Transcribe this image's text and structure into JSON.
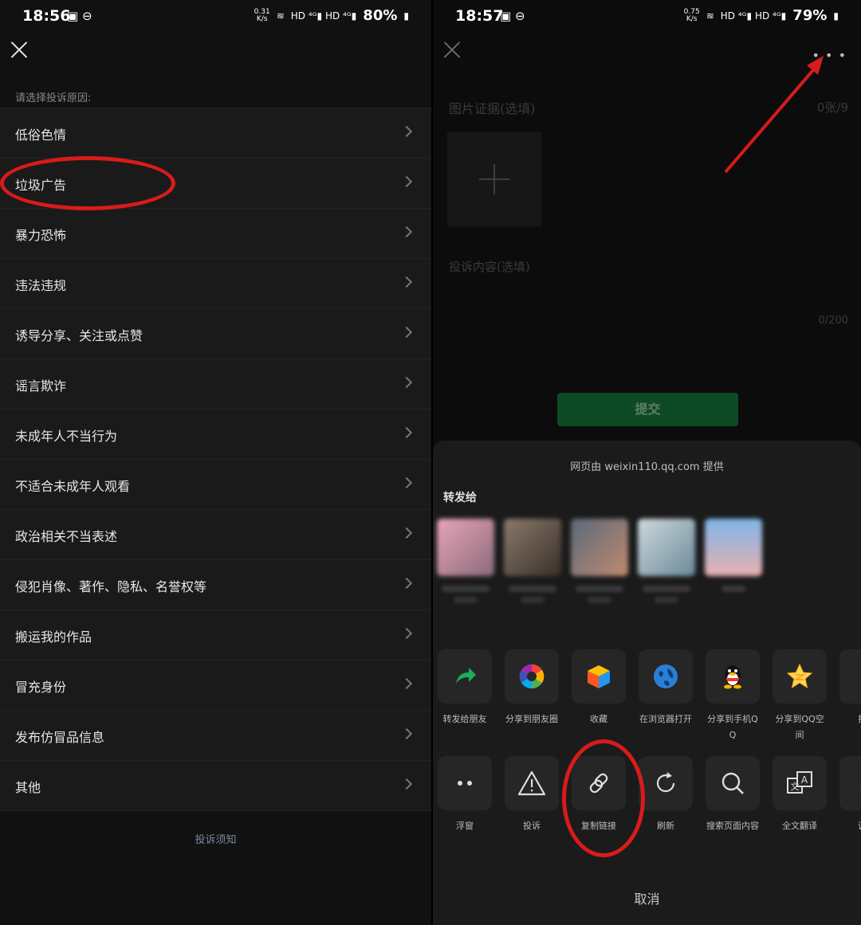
{
  "left": {
    "time": "18:56",
    "net_speed": "0.31\nK/s",
    "battery": "80%",
    "prompt": "请选择投诉原因:",
    "reasons": [
      "低俗色情",
      "垃圾广告",
      "暴力恐怖",
      "违法违规",
      "诱导分享、关注或点赞",
      "谣言欺诈",
      "未成年人不当行为",
      "不适合未成年人观看",
      "政治相关不当表述",
      "侵犯肖像、著作、隐私、名誉权等",
      "搬运我的作品",
      "冒充身份",
      "发布仿冒品信息",
      "其他"
    ],
    "notice": "投诉须知"
  },
  "right": {
    "time": "18:57",
    "net_speed": "0.75\nK/s",
    "battery": "79%",
    "form": {
      "image_title": "图片证据(选填)",
      "image_count": "0张/9",
      "content_placeholder": "投诉内容(选填)",
      "char_count": "0/200",
      "submit": "提交"
    },
    "sheet": {
      "provider": "网页由 weixin110.qq.com 提供",
      "forward_to": "转发给",
      "row1": [
        {
          "label": "转发给朋友",
          "icon": "forward-icon"
        },
        {
          "label": "分享到朋友圈",
          "icon": "moments-icon"
        },
        {
          "label": "收藏",
          "icon": "favorite-cube-icon"
        },
        {
          "label": "在浏览器打开",
          "icon": "browser-globe-icon"
        },
        {
          "label": "分享到手机QQ",
          "icon": "qq-penguin-icon"
        },
        {
          "label": "分享到QQ空间",
          "icon": "qzone-star-icon"
        },
        {
          "label": "打开",
          "icon": "open-icon"
        }
      ],
      "row2": [
        {
          "label": "浮窗",
          "icon": "float-window-icon"
        },
        {
          "label": "投诉",
          "icon": "warning-icon"
        },
        {
          "label": "复制链接",
          "icon": "link-icon"
        },
        {
          "label": "刷新",
          "icon": "refresh-icon"
        },
        {
          "label": "搜索页面内容",
          "icon": "search-icon"
        },
        {
          "label": "全文翻译",
          "icon": "translate-icon"
        },
        {
          "label": "调整",
          "icon": "font-size-icon"
        }
      ],
      "cancel": "取消"
    }
  },
  "colors": {
    "highlight": "#d81b1b",
    "submit_green": "#0f4a26",
    "forward_green": "#1aad5a"
  }
}
